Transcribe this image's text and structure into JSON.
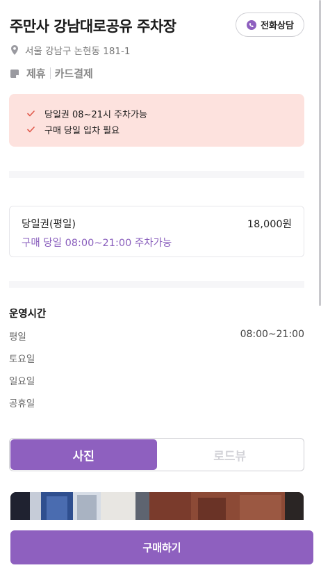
{
  "header": {
    "title": "주만사 강남대로공유 주차장",
    "call_button_label": "전화상담",
    "address": "서울 강남구 논현동 181-1",
    "tags": [
      "제휴",
      "카드결제"
    ]
  },
  "notice": {
    "items": [
      "당일권 08~21시 주차가능",
      "구매 당일 입차 필요"
    ]
  },
  "ticket": {
    "name": "당일권(평일)",
    "price": "18,000원",
    "description": "구매 당일 08:00~21:00 주차가능"
  },
  "hours": {
    "title": "운영시간",
    "rows": [
      {
        "day": "평일",
        "time": "08:00~21:00"
      },
      {
        "day": "토요일",
        "time": ""
      },
      {
        "day": "일요일",
        "time": ""
      },
      {
        "day": "공휴일",
        "time": ""
      }
    ]
  },
  "media_tabs": {
    "tabs": [
      "사진",
      "로드뷰"
    ],
    "active": "사진"
  },
  "footer": {
    "buy_label": "구매하기"
  },
  "colors": {
    "accent": "#8e60bf",
    "notice_bg": "#fde2de",
    "check": "#e0584a"
  }
}
